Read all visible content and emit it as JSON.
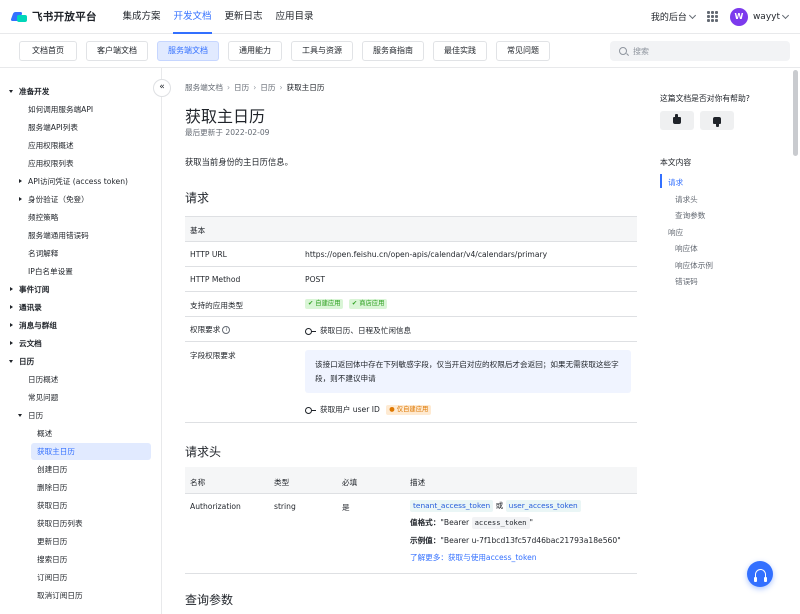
{
  "header": {
    "logo_text": "飞书开放平台",
    "nav": [
      "集成方案",
      "开发文档",
      "更新日志",
      "应用目录"
    ],
    "active_nav": 1,
    "backend_label": "我的后台",
    "avatar_letter": "W",
    "username": "wayyt"
  },
  "subnav": {
    "tabs": [
      "文档首页",
      "客户端文档",
      "服务端文档",
      "通用能力",
      "工具与资源",
      "服务商指南",
      "最佳实践",
      "常见问题"
    ],
    "active_tab": 2,
    "search_placeholder": "搜索"
  },
  "sidebar": {
    "collapse_glyph": "«",
    "items": [
      {
        "label": "准备开发",
        "expand": "down"
      },
      {
        "label": "如何调用服务端API"
      },
      {
        "label": "服务端API列表"
      },
      {
        "label": "应用权限概述"
      },
      {
        "label": "应用权限列表"
      },
      {
        "label": "API访问凭证 (access token)",
        "expand": "right"
      },
      {
        "label": "身份验证（免登）",
        "expand": "right"
      },
      {
        "label": "频控策略"
      },
      {
        "label": "服务端通用错误码"
      },
      {
        "label": "名词解释"
      },
      {
        "label": "IP白名单设置"
      },
      {
        "label": "事件订阅",
        "expand": "right"
      },
      {
        "label": "通讯录",
        "expand": "right"
      },
      {
        "label": "消息与群组",
        "expand": "right"
      },
      {
        "label": "云文档",
        "expand": "right"
      },
      {
        "label": "日历",
        "expand": "down"
      },
      {
        "label": "日历概述"
      },
      {
        "label": "常见问题"
      },
      {
        "label": "日历",
        "expand": "down"
      },
      {
        "label": "概述"
      },
      {
        "label": "获取主日历",
        "selected": true
      },
      {
        "label": "创建日历"
      },
      {
        "label": "删除日历"
      },
      {
        "label": "获取日历"
      },
      {
        "label": "获取日历列表"
      },
      {
        "label": "更新日历"
      },
      {
        "label": "搜索日历"
      },
      {
        "label": "订阅日历"
      },
      {
        "label": "取消订阅日历"
      }
    ]
  },
  "main": {
    "breadcrumb": [
      "服务端文档",
      "日历",
      "日历",
      "获取主日历"
    ],
    "title": "获取主日历",
    "updated": "最后更新于 2022-02-09",
    "description": "获取当前身份的主日历信息。",
    "request_heading": "请求",
    "basic_label": "基本",
    "rows": {
      "url_key": "HTTP URL",
      "url_val": "https://open.feishu.cn/open-apis/calendar/v4/calendars/primary",
      "method_key": "HTTP Method",
      "method_val": "POST",
      "apptype_key": "支持的应用类型",
      "apptype_badges": [
        "自建应用",
        "商店应用"
      ],
      "perm_key": "权限要求",
      "perm_info_glyph": "i",
      "perm_val": "获取日历、日程及忙闲信息",
      "field_key": "字段权限要求",
      "notice": "该接口返回体中存在下列敏感字段，仅当开启对应的权限后才会返回；如果无需获取这些字段，则不建议申请",
      "field_perm": "获取用户 user ID",
      "field_badge": "仅自建应用"
    },
    "header_heading": "请求头",
    "header_table": {
      "columns": [
        "名称",
        "类型",
        "必填",
        "描述"
      ],
      "row": {
        "name": "Authorization",
        "type": "string",
        "required": "是",
        "token1": "tenant_access_token",
        "or": "或",
        "token2": "user_access_token",
        "format_label": "值格式：",
        "format_pre": "\"Bearer ",
        "format_code": "access_token",
        "format_post": "\"",
        "example_label": "示例值：",
        "example_val": "\"Bearer u-7f1bcd13fc57d46bac21793a18e560\"",
        "more_label": "了解更多：",
        "more_link": "获取与使用access_token"
      }
    },
    "query_heading": "查询参数"
  },
  "right": {
    "help_question": "这篇文档是否对你有帮助?",
    "toc_title": "本文内容",
    "toc": [
      {
        "label": "请求",
        "level": 1,
        "active": true
      },
      {
        "label": "请求头",
        "level": 2
      },
      {
        "label": "查询参数",
        "level": 2
      },
      {
        "label": "响应",
        "level": 1
      },
      {
        "label": "响应体",
        "level": 2
      },
      {
        "label": "响应体示例",
        "level": 2
      },
      {
        "label": "错误码",
        "level": 2
      }
    ]
  },
  "colors": {
    "accent": "#3370ff",
    "selected_bg": "#e1eaff",
    "avatar": "#7c3aed",
    "green": "#2ea121",
    "orange": "#de7802"
  },
  "icons": [
    "logo-icon",
    "chevron-down-icon",
    "apps-grid-icon",
    "search-icon",
    "collapse-icon",
    "info-icon",
    "key-icon",
    "thumbs-up-icon",
    "thumbs-down-icon",
    "headset-icon",
    "check-icon"
  ]
}
